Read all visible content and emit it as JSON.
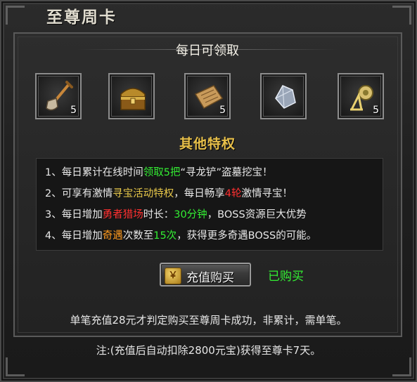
{
  "window": {
    "title": "至尊周卡"
  },
  "daily": {
    "title": "每日可领取",
    "items": [
      {
        "icon": "shovel-icon",
        "count": "5"
      },
      {
        "icon": "treasure-chest-icon",
        "count": ""
      },
      {
        "icon": "scroll-icon",
        "count": "5"
      },
      {
        "icon": "crystal-icon",
        "count": ""
      },
      {
        "icon": "fishing-reel-icon",
        "count": "5"
      }
    ]
  },
  "perks": {
    "title": "其他特权",
    "lines": [
      {
        "a": "1、每日累计在线时间",
        "b": "领取5把",
        "c": "“寻龙铲”盗墓挖宝！"
      },
      {
        "a": "2、可享有激情",
        "b": "寻宝活动特权",
        "c": "，每日畅享",
        "d": "4轮",
        "e": "激情寻宝！"
      },
      {
        "a": "3、每日增加",
        "b": "勇者猎场",
        "c": "时长：",
        "d": "30分钟",
        "e": "，BOSS资源巨大优势"
      },
      {
        "a": "4、每日增加",
        "b": "奇遇",
        "c": "次数至",
        "d": "15次",
        "e": "，获得更多奇遇BOSS的可能。"
      }
    ]
  },
  "actions": {
    "recharge_label": "充值购买",
    "coin_glyph": "￥",
    "purchased_label": "已购买"
  },
  "notes": {
    "line1": "单笔充值28元才判定购买至尊周卡成功，非累计，需单笔。",
    "line2": "注:(充值后自动扣除2800元宝)获得至尊卡7天。"
  },
  "colors": {
    "gold": "#e8c04a",
    "green": "#33ee33",
    "red": "#ff3030",
    "orange": "#ff9a1e"
  }
}
